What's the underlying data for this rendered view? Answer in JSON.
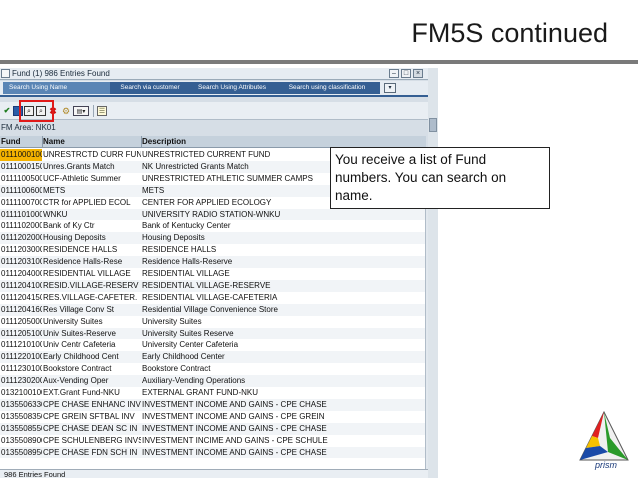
{
  "slide": {
    "title": "FM5S continued"
  },
  "window": {
    "title": "Fund (1)  986 Entries Found",
    "controls": [
      "minimize",
      "maximize",
      "close"
    ]
  },
  "tabs": [
    {
      "label": "Search Using Name",
      "active": true
    },
    {
      "label": "Search via customer",
      "active": false
    },
    {
      "label": "Search Using Attributes",
      "active": false
    },
    {
      "label": "Search using classification",
      "active": false
    }
  ],
  "toolbar": {
    "icons": [
      "check-icon",
      "stop-icon",
      "find-icon",
      "find-next-icon",
      "cancel-icon",
      "settings-icon",
      "selection-icon",
      "list-icon"
    ],
    "check_glyph": "✔",
    "find_glyph": "⌕",
    "find_next_glyph": "⌕",
    "cancel_glyph": "✖",
    "settings_glyph": "⚙",
    "select_glyph": "▤▾",
    "list_glyph": "☰"
  },
  "fm_area": "FM Area: NK01",
  "grid": {
    "columns": [
      "Fund",
      "Name",
      "Description"
    ],
    "selected_row": 0,
    "rows": [
      {
        "fund": "0111000100",
        "name": "UNRESTRCTD CURR FUND",
        "desc": "UNRESTRICTED CURRENT FUND"
      },
      {
        "fund": "0111000150",
        "name": "Unres.Grants Match",
        "desc": "NK Unrestricted Grants Match"
      },
      {
        "fund": "0111100500",
        "name": "UCF-Athletic Summer",
        "desc": "UNRESTRICTED ATHLETIC SUMMER CAMPS"
      },
      {
        "fund": "0111100600",
        "name": "METS",
        "desc": "METS"
      },
      {
        "fund": "0111100700",
        "name": "CTR for APPLIED ECOL",
        "desc": "CENTER FOR APPLIED ECOLOGY"
      },
      {
        "fund": "0111101000",
        "name": "WNKU",
        "desc": "UNIVERSITY RADIO STATION-WNKU"
      },
      {
        "fund": "0111102000",
        "name": "Bank of Ky Ctr",
        "desc": "Bank of Kentucky Center"
      },
      {
        "fund": "0111202000",
        "name": "Housing Deposits",
        "desc": "Housing Deposits"
      },
      {
        "fund": "0111203000",
        "name": "RESIDENCE HALLS",
        "desc": "RESIDENCE HALLS"
      },
      {
        "fund": "0111203100",
        "name": "Residence Halls-Rese",
        "desc": "Residence Halls-Reserve"
      },
      {
        "fund": "0111204000",
        "name": "RESIDENTIAL VILLAGE",
        "desc": "RESIDENTIAL VILLAGE"
      },
      {
        "fund": "0111204100",
        "name": "RESID.VILLAGE-RESERV",
        "desc": "RESIDENTIAL VILLAGE-RESERVE"
      },
      {
        "fund": "0111204150",
        "name": "RES.VILLAGE-CAFETER.",
        "desc": "RESIDENTIAL VILLAGE-CAFETERIA"
      },
      {
        "fund": "0111204160",
        "name": "Res Village Conv St",
        "desc": "Residential Village Convenience Store"
      },
      {
        "fund": "0111205000",
        "name": "University Suites",
        "desc": "University Suites"
      },
      {
        "fund": "0111205100",
        "name": "Univ Suites-Reserve",
        "desc": "University Suites Reserve"
      },
      {
        "fund": "0111210100",
        "name": "Univ Centr Cafeteria",
        "desc": "University Center Cafeteria"
      },
      {
        "fund": "0111220100",
        "name": "Early Childhood Cent",
        "desc": "Early Childhood Center"
      },
      {
        "fund": "0111230100",
        "name": "Bookstore Contract",
        "desc": "Bookstore Contract"
      },
      {
        "fund": "0111230200",
        "name": "Aux-Vending Oper",
        "desc": "Auxiliary-Vending Operations"
      },
      {
        "fund": "0132100100",
        "name": "EXT.Grant Fund-NKU",
        "desc": "EXTERNAL GRANT FUND-NKU"
      },
      {
        "fund": "0135506330",
        "name": "CPE CHASE ENHANC INV",
        "desc": "INVESTMENT INCOME AND GAINS - CPE CHASE"
      },
      {
        "fund": "0135508350",
        "name": "CPE GREIN SFTBAL INV",
        "desc": "INVESTMENT INCOME AND GAINS - CPE GREIN"
      },
      {
        "fund": "0135508550",
        "name": "CPE CHASE DEAN SC IN",
        "desc": "INVESTMENT INCOME AND GAINS - CPE CHASE"
      },
      {
        "fund": "0135508900",
        "name": "CPE SCHULENBERG INVS",
        "desc": "INVESTMENT INCIME AND GAINS - CPE SCHULE"
      },
      {
        "fund": "0135508950",
        "name": "CPE CHASE FDN SCH IN",
        "desc": "INVESTMENT INCOME AND GAINS - CPE CHASE"
      }
    ]
  },
  "status_bar": "986 Entries Found",
  "callout": "You receive a list of Fund numbers.  You can search on name.",
  "logo": {
    "text": "prism",
    "colors": [
      "#e02020",
      "#f5c000",
      "#2a9a2a",
      "#1a4aa8"
    ]
  },
  "colors": {
    "tab_active": "#5a85b5",
    "tab_inactive": "#355f93",
    "selection": "#f5b300",
    "highlight_box": "#e01a1a"
  }
}
